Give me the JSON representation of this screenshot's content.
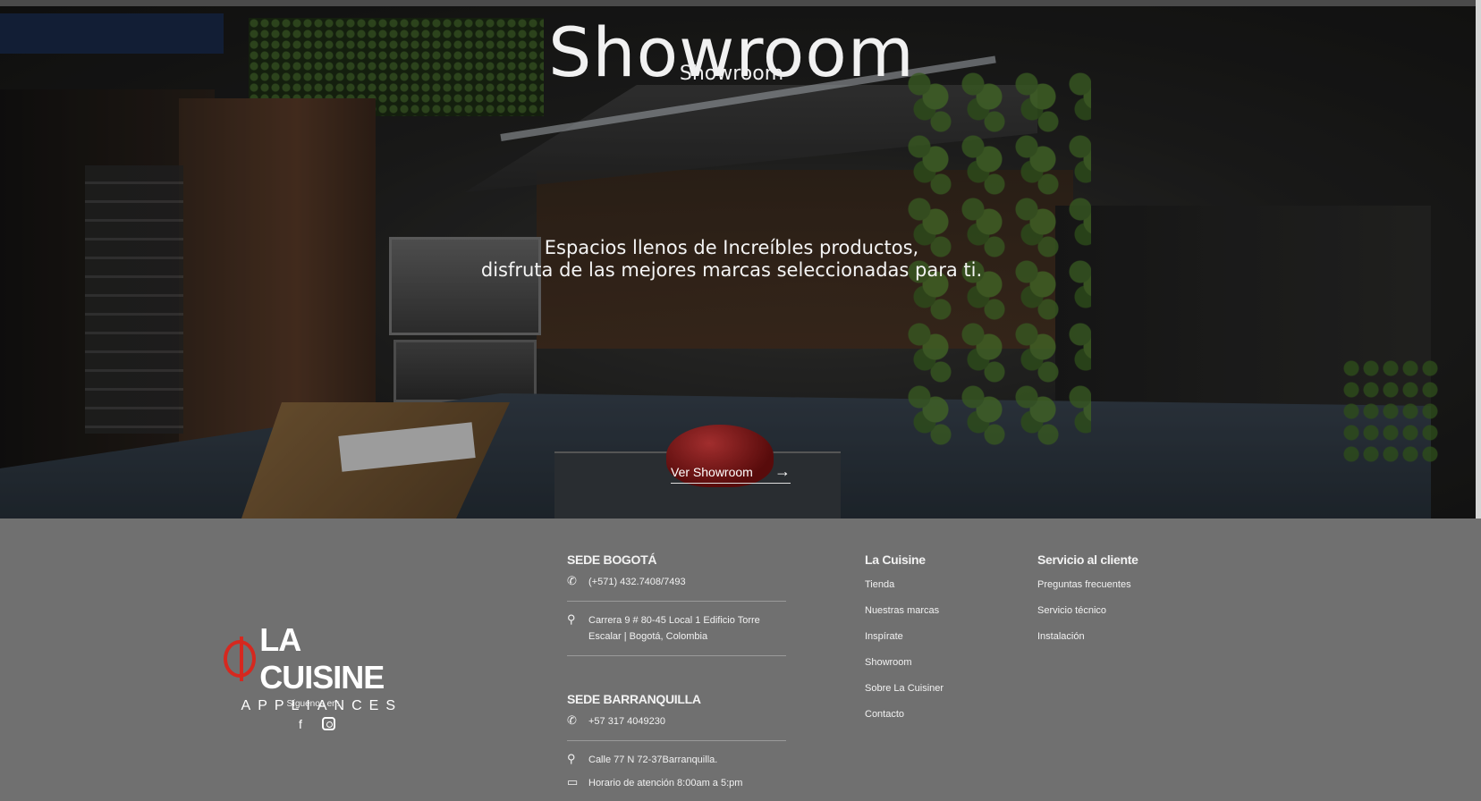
{
  "hero": {
    "title": "Showroom",
    "subtitle": "Showroom",
    "tagline_line1": "Espacios llenos de Increíbles productos,",
    "tagline_line2": "disfruta de las mejores marcas seleccionadas para ti.",
    "cta_label": "Ver Showroom",
    "cta_arrow": "→"
  },
  "footer": {
    "logo_name": "LA CUISINE",
    "logo_sub": "APPLIANCES",
    "follow_label": "Síguenos en:",
    "social": [
      "facebook-icon",
      "instagram-icon"
    ],
    "sede_bogota": {
      "heading": "SEDE BOGOTÁ",
      "phone": "(+571) 432.7408/7493",
      "address": "Carrera 9 # 80-45 Local 1 Edificio Torre Escalar | Bogotá, Colombia"
    },
    "sede_barranquilla": {
      "heading": "SEDE BARRANQUILLA",
      "phone": "+57 317 4049230",
      "address": "Calle 77 N 72-37Barranquilla.",
      "hours": "Horario de atención 8:00am a 5:pm"
    },
    "col_la_cuisine": {
      "heading": "La Cuisine",
      "links": [
        "Tienda",
        "Nuestras marcas",
        "Inspírate",
        "Showroom",
        "Sobre La Cuisiner",
        "Contacto"
      ]
    },
    "col_servicio": {
      "heading": "Servicio al cliente",
      "links": [
        "Preguntas frecuentes",
        "Servicio técnico",
        "Instalación"
      ]
    }
  },
  "colors": {
    "brand_red": "#d6281f",
    "footer_bg": "#707070"
  }
}
